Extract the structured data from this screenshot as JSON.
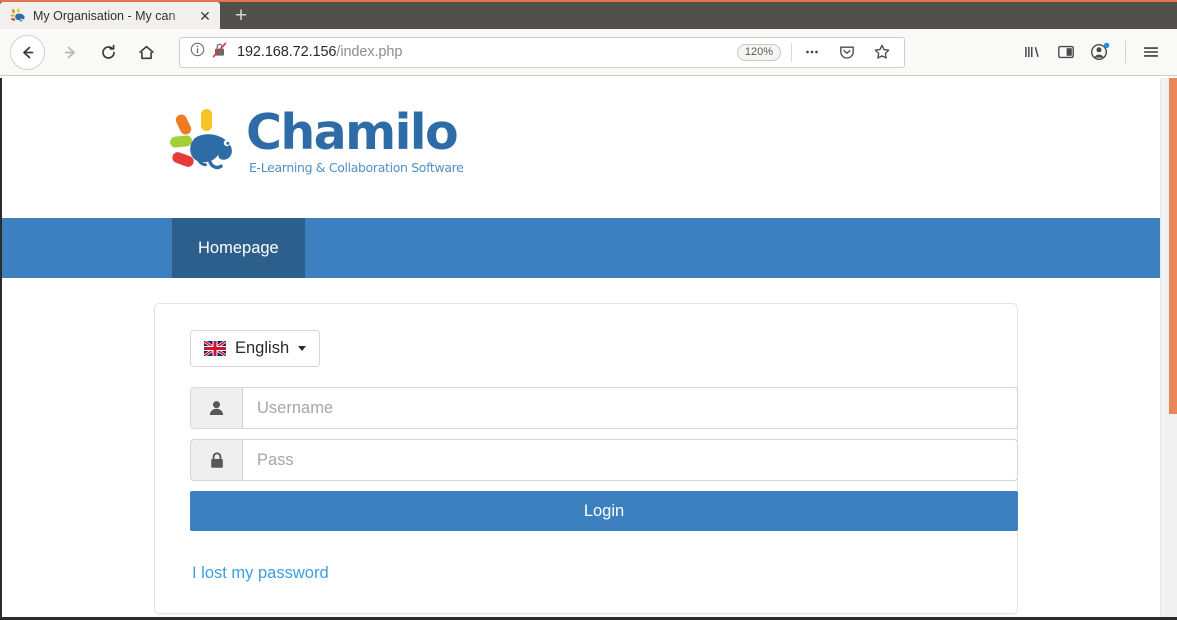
{
  "browser": {
    "tab": {
      "favicon": "chamilo-favicon",
      "title": "My Organisation - My can",
      "close_label": "✕"
    },
    "new_tab_label": "+",
    "nav": {
      "back_icon": "back-arrow-icon",
      "forward_icon": "forward-arrow-icon",
      "reload_icon": "reload-icon",
      "home_icon": "home-icon"
    },
    "urlbar": {
      "info_icon": "page-info-icon",
      "security_icon": "insecure-connection-icon",
      "url_host": "192.168.72.156",
      "url_path": "/index.php",
      "zoom_level": "120%",
      "more_icon": "ellipsis-icon",
      "pocket_icon": "save-to-pocket-icon",
      "bookmark_icon": "star-icon"
    },
    "toolbar": {
      "library_icon": "library-icon",
      "sidebar_icon": "sidebar-icon",
      "account_icon": "account-icon",
      "menu_icon": "hamburger-menu-icon"
    }
  },
  "page": {
    "logo": {
      "mark": "chamilo-chameleon-logo",
      "wordmark": "Chamilo",
      "tagline": "E-Learning & Collaboration Software",
      "colors": {
        "wordmark": "#2d6ca7",
        "tagline": "#4f92c4",
        "ray_yellow": "#f4c524",
        "ray_orange": "#ef7c23",
        "ray_green": "#a6ce39",
        "ray_red": "#e53b3b",
        "chameleon": "#2d6ca7"
      }
    },
    "nav": {
      "background": "#3c80bf",
      "active_background": "#2c5f8c",
      "items": [
        {
          "label": "Homepage",
          "active": true
        }
      ]
    },
    "login": {
      "language": {
        "flag": "uk-flag-icon",
        "label": "English",
        "caret": "chevron-down-icon"
      },
      "username": {
        "icon": "user-icon",
        "placeholder": "Username",
        "value": ""
      },
      "password": {
        "icon": "lock-icon",
        "placeholder": "Pass",
        "value": ""
      },
      "submit_label": "Login",
      "submit_color": "#3c80bf",
      "lost_password_label": "I lost my password",
      "lost_password_color": "#3c9ee0"
    }
  },
  "scrollbar": {
    "thumb_color": "#e8875c",
    "track_color": "#f1f1f1"
  }
}
